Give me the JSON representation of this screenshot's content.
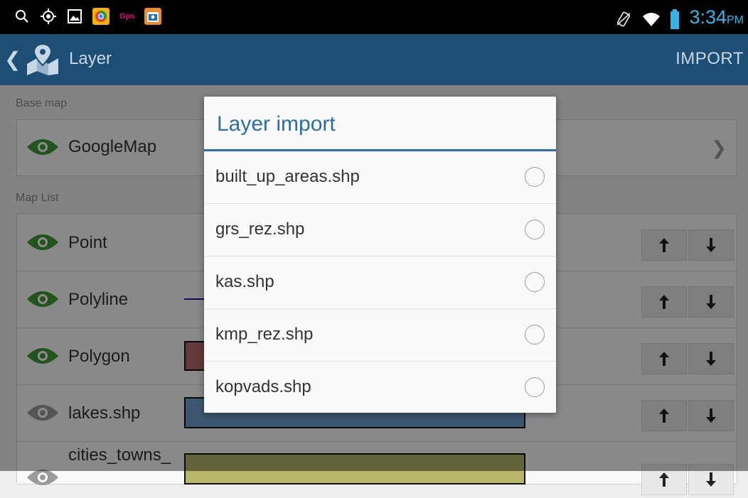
{
  "status_bar": {
    "time": "3:34",
    "ampm": "PM",
    "gps_label": "Gps"
  },
  "app_bar": {
    "title": "Layer",
    "action": "IMPORT"
  },
  "base_map": {
    "section_label": "Base map",
    "name": "GoogleMap"
  },
  "map_list": {
    "section_label": "Map List",
    "items": [
      {
        "name": "Point",
        "visible": true
      },
      {
        "name": "Polyline",
        "visible": true,
        "swatch_color": "#1a1a8c"
      },
      {
        "name": "Polygon",
        "visible": true,
        "swatch_color": "#b56a6a"
      },
      {
        "name": "lakes.shp",
        "visible": false,
        "swatch_color": "#6f9fcc"
      },
      {
        "name": "cities_towns_",
        "visible": false,
        "swatch_color": "#b7b66b"
      }
    ]
  },
  "dialog": {
    "title": "Layer import",
    "items": [
      "built_up_areas.shp",
      "grs_rez.shp",
      "kas.shp",
      "kmp_rez.shp",
      "kopvads.shp"
    ]
  },
  "colors": {
    "accent": "#2c6ea5",
    "app_bar": "#1d4e76",
    "eye_visible": "#3d9b35",
    "eye_hidden": "#9a9a9a",
    "time": "#33b5e5"
  }
}
